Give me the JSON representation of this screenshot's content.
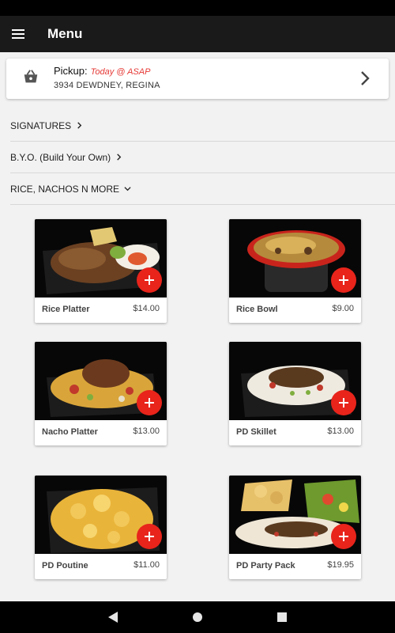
{
  "appbar": {
    "title": "Menu",
    "menu_icon": "hamburger-menu-icon"
  },
  "pickup": {
    "label": "Pickup:",
    "time": "Today @ ASAP",
    "address": "3934 DEWDNEY, REGINA",
    "icon": "basket-icon",
    "accent_color": "#e53935"
  },
  "categories": [
    {
      "label": "SIGNATURES",
      "state": "collapsed"
    },
    {
      "label": "B.Y.O. (Build Your Own)",
      "state": "collapsed"
    },
    {
      "label": "RICE, NACHOS N MORE",
      "state": "expanded"
    }
  ],
  "products": [
    {
      "name": "Rice Platter",
      "price": "$14.00"
    },
    {
      "name": "Rice Bowl",
      "price": "$9.00"
    },
    {
      "name": "Nacho Platter",
      "price": "$13.00"
    },
    {
      "name": "PD Skillet",
      "price": "$13.00"
    },
    {
      "name": "PD Poutine",
      "price": "$11.00"
    },
    {
      "name": "PD Party Pack",
      "price": "$19.95"
    }
  ],
  "add_button_color": "#e8241b"
}
